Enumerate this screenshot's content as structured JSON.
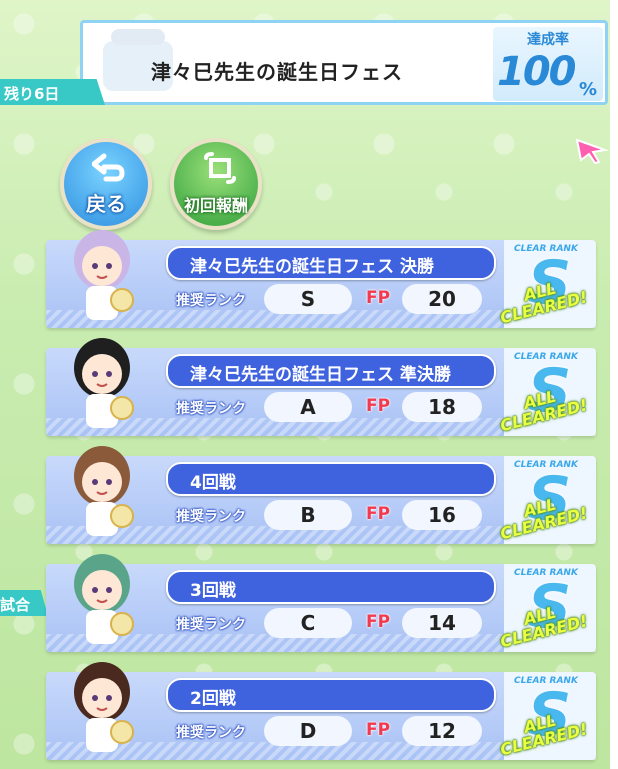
{
  "header": {
    "fes_title": "津々巳先生の誕生日フェス",
    "rate_label": "達成率",
    "rate_value": "100",
    "rate_unit": "%",
    "days_left": "残り6日"
  },
  "buttons": {
    "back_label": "戻る",
    "first_reward_label": "初回報酬"
  },
  "side_tab": "試合",
  "stages": [
    {
      "name": "津々巳先生の誕生日フェス 決勝",
      "rec_label": "推奨ランク",
      "rank": "S",
      "fp_label": "FP",
      "fp": "20",
      "clear_rank_label": "CLEAR RANK",
      "clear_rank": "S",
      "status": "ALL CLEARED!",
      "avatar_hair": "#c9b6e6"
    },
    {
      "name": "津々巳先生の誕生日フェス 準決勝",
      "rec_label": "推奨ランク",
      "rank": "A",
      "fp_label": "FP",
      "fp": "18",
      "clear_rank_label": "CLEAR RANK",
      "clear_rank": "S",
      "status": "ALL CLEARED!",
      "avatar_hair": "#1f1f1f"
    },
    {
      "name": "4回戦",
      "rec_label": "推奨ランク",
      "rank": "B",
      "fp_label": "FP",
      "fp": "16",
      "clear_rank_label": "CLEAR RANK",
      "clear_rank": "S",
      "status": "ALL CLEARED!",
      "avatar_hair": "#8a5a3b"
    },
    {
      "name": "3回戦",
      "rec_label": "推奨ランク",
      "rank": "C",
      "fp_label": "FP",
      "fp": "14",
      "clear_rank_label": "CLEAR RANK",
      "clear_rank": "S",
      "status": "ALL CLEARED!",
      "avatar_hair": "#5aa58a"
    },
    {
      "name": "2回戦",
      "rec_label": "推奨ランク",
      "rank": "D",
      "fp_label": "FP",
      "fp": "12",
      "clear_rank_label": "CLEAR RANK",
      "clear_rank": "S",
      "status": "ALL CLEARED!",
      "avatar_hair": "#4a2a1e"
    }
  ],
  "colors": {
    "accent_blue": "#3f62df",
    "teal_tab": "#38c9c6",
    "fp_red": "#f23a4f",
    "cleared_yellow": "#e9ff3f"
  },
  "icons": [
    "cake-icon",
    "back-arrow-icon",
    "reward-icon",
    "pointer-cursor-icon"
  ]
}
